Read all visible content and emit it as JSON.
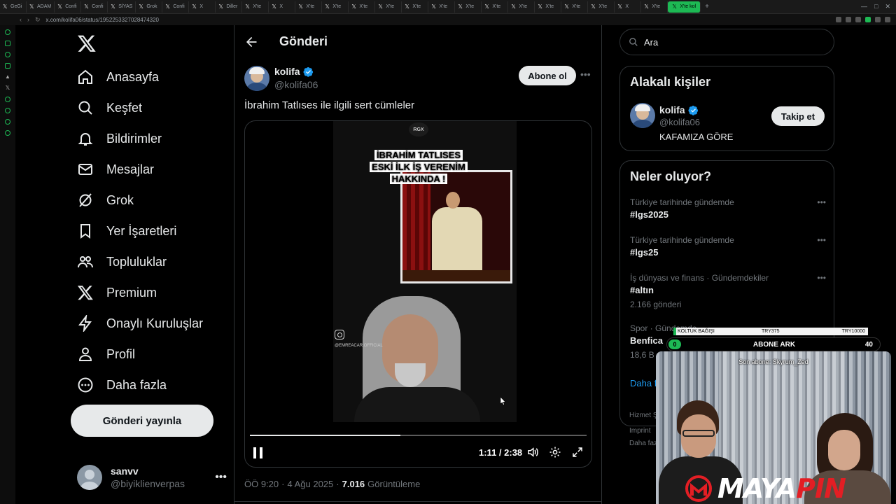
{
  "browser": {
    "tabs": [
      {
        "label": "GeGi"
      },
      {
        "label": "ADAM"
      },
      {
        "label": "Confi"
      },
      {
        "label": "Confi"
      },
      {
        "label": "SİYAS"
      },
      {
        "label": "Grok"
      },
      {
        "label": "Confi"
      },
      {
        "label": "X"
      },
      {
        "label": "Diller"
      },
      {
        "label": "X'te"
      },
      {
        "label": "X"
      },
      {
        "label": "X'te"
      },
      {
        "label": "X'te"
      },
      {
        "label": "X'te"
      },
      {
        "label": "X'te"
      },
      {
        "label": "X'te"
      },
      {
        "label": "X'te"
      },
      {
        "label": "X'te"
      },
      {
        "label": "X'te"
      },
      {
        "label": "X'te"
      },
      {
        "label": "X'te"
      },
      {
        "label": "X'te"
      },
      {
        "label": "X'te"
      },
      {
        "label": "X"
      },
      {
        "label": "X'te"
      }
    ],
    "active_tab": "X'te kol",
    "new_tab": "+",
    "url": "x.com/kolifa06/status/1952253327028474320"
  },
  "nav": {
    "items": [
      {
        "label": "Anasayfa",
        "icon": "home-icon"
      },
      {
        "label": "Keşfet",
        "icon": "search-icon"
      },
      {
        "label": "Bildirimler",
        "icon": "bell-icon"
      },
      {
        "label": "Mesajlar",
        "icon": "mail-icon"
      },
      {
        "label": "Grok",
        "icon": "grok-icon"
      },
      {
        "label": "Yer İşaretleri",
        "icon": "bookmark-icon"
      },
      {
        "label": "Topluluklar",
        "icon": "communities-icon"
      },
      {
        "label": "Premium",
        "icon": "x-premium-icon"
      },
      {
        "label": "Onaylı Kuruluşlar",
        "icon": "lightning-icon"
      },
      {
        "label": "Profil",
        "icon": "person-icon"
      },
      {
        "label": "Daha fazla",
        "icon": "more-circle-icon"
      }
    ],
    "post_button": "Gönderi yayınla",
    "account": {
      "name": "sanvv",
      "handle": "@biyiklienverpas"
    }
  },
  "main": {
    "title": "Gönderi",
    "tweet": {
      "name": "kolifa",
      "handle": "@kolifa06",
      "subscribe": "Abone ol",
      "text": "İbrahim Tatlıses ile ilgili sert cümleler",
      "video": {
        "badge": "RGX",
        "caption_line1": "İBRAHİM TATLISES",
        "caption_line2": "ESKİ İLK İŞ VERENİM",
        "caption_line3": "HAKKINDA !",
        "watermark": "@EMREACAR.OFFICIAL",
        "time": "1:11 / 2:38",
        "progress": 0.447
      },
      "time": "ÖÖ 9:20",
      "date": "4 Ağu 2025",
      "views": "7.016",
      "views_label": "Görüntüleme"
    }
  },
  "right": {
    "search_placeholder": "Ara",
    "related_title": "Alakalı kişiler",
    "related": {
      "name": "kolifa",
      "handle": "@kolifa06",
      "bio": "KAFAMIZA GÖRE",
      "follow": "Takip et"
    },
    "trends_title": "Neler oluyor?",
    "trends": [
      {
        "category": "Türkiye tarihinde gündemde",
        "name": "#lgs2025",
        "count": ""
      },
      {
        "category": "Türkiye tarihinde gündemde",
        "name": "#lgs25",
        "count": ""
      },
      {
        "category": "İş dünyası ve finans · Gündemdekiler",
        "name": "#altın",
        "count": "2.166 gönderi"
      },
      {
        "category": "Spor · Gündemde",
        "name": "Benfica",
        "count": "18,6 B gönderi"
      }
    ],
    "show_more": "Daha fazla göster",
    "footer": [
      "Hizmet Şartları",
      "Imprint",
      "Daha fazla"
    ]
  },
  "overlay": {
    "donation_label": "KOLTUK BAĞIŞI",
    "donation_min": "TRY375",
    "donation_max": "TRY10000",
    "sub_current": "0",
    "sub_label": "ABONE ARK",
    "sub_goal": "40",
    "last_sub": "Son abone: Skyrum_Zed",
    "brand_a": "MAYA",
    "brand_b": "PIN"
  }
}
